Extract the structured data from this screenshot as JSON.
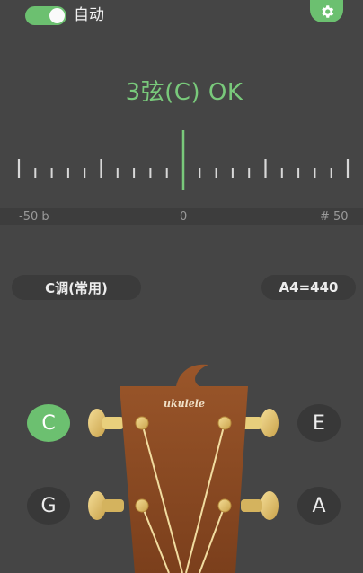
{
  "header": {
    "auto_label": "自动",
    "auto_enabled": true,
    "settings_icon": "gear-icon",
    "accent_color": "#6cc070"
  },
  "tuner": {
    "status": "3弦(C) OK",
    "scale_left": "-50 b",
    "scale_center": "0",
    "scale_right": "# 50",
    "needle_cents": 0,
    "needle_color": "#79c97b"
  },
  "controls": {
    "key_label": "C调(常用)",
    "reference_label": "A4=440"
  },
  "strings": [
    {
      "label": "C",
      "active": true
    },
    {
      "label": "E",
      "active": false
    },
    {
      "label": "G",
      "active": false
    },
    {
      "label": "A",
      "active": false
    }
  ],
  "headstock": {
    "brand": "ukulele",
    "wood_color": "#8a4a22"
  }
}
